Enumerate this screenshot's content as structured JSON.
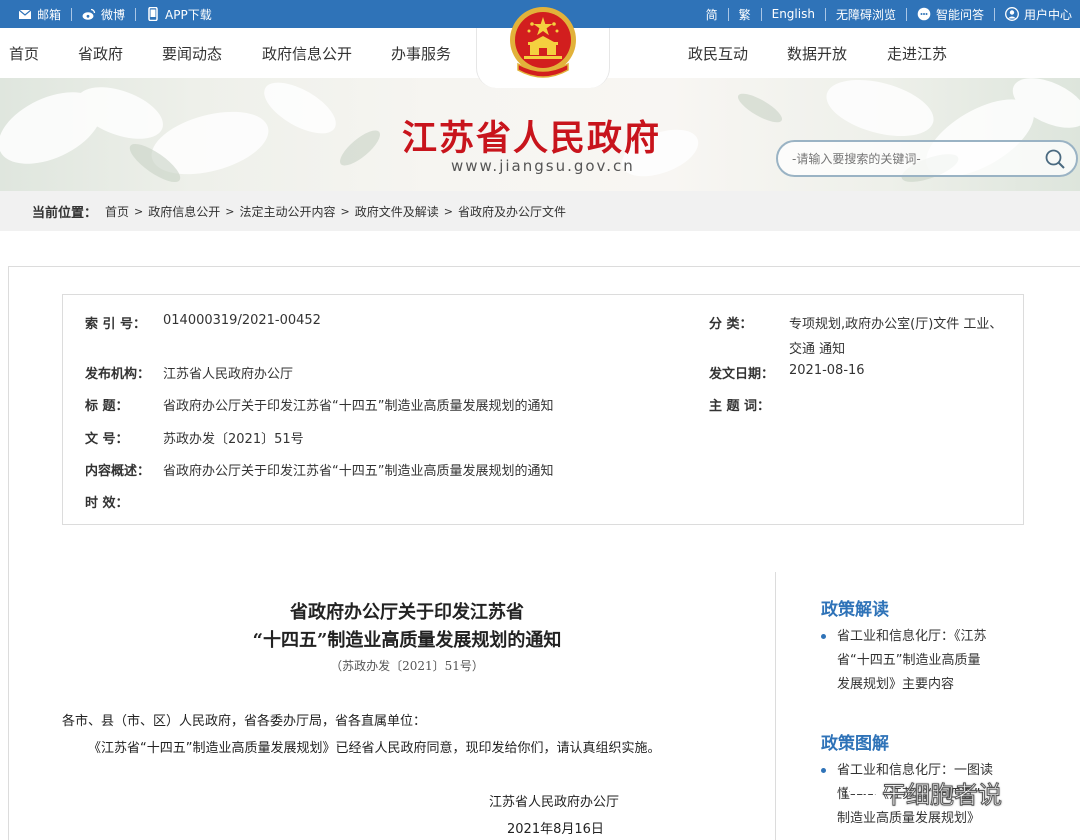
{
  "topbar": {
    "left": [
      {
        "icon": "mail-icon",
        "label": "邮箱"
      },
      {
        "icon": "weibo-icon",
        "label": "微博"
      },
      {
        "icon": "phone-icon",
        "label": "APP下载"
      }
    ],
    "right": [
      {
        "label": "简"
      },
      {
        "label": "繁"
      },
      {
        "label": "English"
      },
      {
        "label": "无障碍浏览"
      },
      {
        "icon": "chat-icon",
        "label": "智能问答"
      },
      {
        "icon": "user-icon",
        "label": "用户中心"
      }
    ]
  },
  "nav": {
    "items": [
      "首页",
      "省政府",
      "要闻动态",
      "政府信息公开",
      "办事服务",
      "政民互动",
      "数据开放",
      "走进江苏"
    ]
  },
  "header": {
    "title": "江苏省人民政府",
    "url": "www.jiangsu.gov.cn",
    "search_placeholder": "-请输入要搜索的关键词-"
  },
  "breadcrumb": {
    "label": "当前位置：",
    "items": [
      "首页",
      "政府信息公开",
      "法定主动公开内容",
      "政府文件及解读",
      "省政府及办公厅文件"
    ]
  },
  "meta": {
    "index_label": "索 引 号：",
    "index_value": "014000319/2021-00452",
    "category_label": "分 类：",
    "category_value_1": "专项规划,政府办公室(厅)文件 工业、",
    "category_value_2": "交通 通知",
    "publisher_label": "发布机构：",
    "publisher_value": "江苏省人民政府办公厅",
    "date_label": "发文日期：",
    "date_value": "2021-08-16",
    "title_label": "标 题：",
    "title_value": "省政府办公厅关于印发江苏省“十四五”制造业高质量发展规划的通知",
    "subject_label": "主 题 词：",
    "subject_value": "",
    "docno_label": "文 号：",
    "docno_value": "苏政办发〔2021〕51号",
    "summary_label": "内容概述：",
    "summary_value": "省政府办公厅关于印发江苏省“十四五”制造业高质量发展规划的通知",
    "validity_label": "时 效：",
    "validity_value": ""
  },
  "document": {
    "title_line1": "省政府办公厅关于印发江苏省",
    "title_line2": "“十四五”制造业高质量发展规划的通知",
    "number": "（苏政办发〔2021〕51号）",
    "salutation": "各市、县（市、区）人民政府，省各委办厅局，省各直属单位：",
    "body": "《江苏省“十四五”制造业高质量发展规划》已经省人民政府同意，现印发给你们，请认真组织实施。",
    "signer": "江苏省人民政府办公厅",
    "date": "2021年8月16日"
  },
  "sidebar": {
    "sections": [
      {
        "heading": "政策解读",
        "items": [
          [
            "省工业和信息化厅：《江苏",
            "省“十四五”制造业高质量",
            "发展规划》主要内容"
          ]
        ]
      },
      {
        "heading": "政策图解",
        "items": [
          [
            "省工业和信息化厅：一图读",
            "懂——《江苏省“十四五”",
            "制造业高质量发展规划》"
          ]
        ]
      }
    ]
  },
  "watermark": {
    "text": "干细胞者说"
  },
  "colors": {
    "primary": "#2f73b8",
    "title_red": "#c8141c",
    "crumb_bg": "#f1f1f1"
  }
}
